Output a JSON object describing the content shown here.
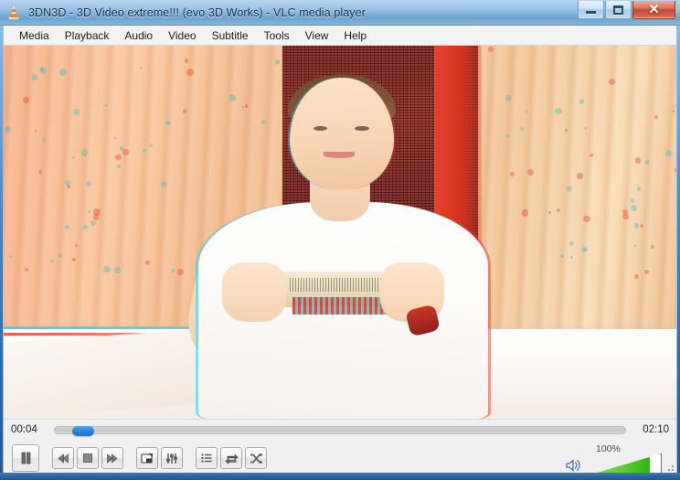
{
  "window": {
    "title": "3DN3D - 3D Video extreme!!! (evo 3D Works) - VLC media player",
    "app_icon": "vlc-cone-icon",
    "controls": {
      "minimize": "–",
      "maximize": "□",
      "close": "✕"
    },
    "frame_color": "#2f6aa8",
    "titlebar_color": "#9cc4e4"
  },
  "menubar": {
    "items": [
      {
        "label": "Media",
        "name": "menu-media"
      },
      {
        "label": "Playback",
        "name": "menu-playback"
      },
      {
        "label": "Audio",
        "name": "menu-audio"
      },
      {
        "label": "Video",
        "name": "menu-video"
      },
      {
        "label": "Subtitle",
        "name": "menu-subtitle"
      },
      {
        "label": "Tools",
        "name": "menu-tools"
      },
      {
        "label": "View",
        "name": "menu-view"
      },
      {
        "label": "Help",
        "name": "menu-help"
      }
    ]
  },
  "video": {
    "description": "Anaglyph 3D (red/cyan) video of a young man sitting on a bed holding a card in front of a wooden plank wall with a dark red woven mat",
    "render_mode": "anaglyph-3d",
    "background_color": "#000000"
  },
  "player": {
    "elapsed_time": "00:04",
    "total_time": "02:10",
    "progress_percent": 3,
    "state": "playing",
    "seek_thumb_color": "#2a84d6"
  },
  "toolbar": {
    "play_pause": {
      "label": "Pause",
      "icon": "pause-icon"
    },
    "previous": {
      "label": "Previous",
      "icon": "previous-icon"
    },
    "stop": {
      "label": "Stop",
      "icon": "stop-icon"
    },
    "next": {
      "label": "Next",
      "icon": "next-icon"
    },
    "fullscreen": {
      "label": "Toggle fullscreen",
      "icon": "fullscreen-icon"
    },
    "extended_settings": {
      "label": "Show extended settings",
      "icon": "equalizer-icon"
    },
    "playlist": {
      "label": "Show playlist",
      "icon": "playlist-icon"
    },
    "loop": {
      "label": "Loop",
      "icon": "loop-icon"
    },
    "random": {
      "label": "Random",
      "icon": "shuffle-icon"
    }
  },
  "volume": {
    "label": "100%",
    "level_percent": 100,
    "icon": "speaker-icon",
    "fill_color": "#27b80a"
  },
  "statusbar": {
    "resize_grip": "resize-grip-icon"
  }
}
